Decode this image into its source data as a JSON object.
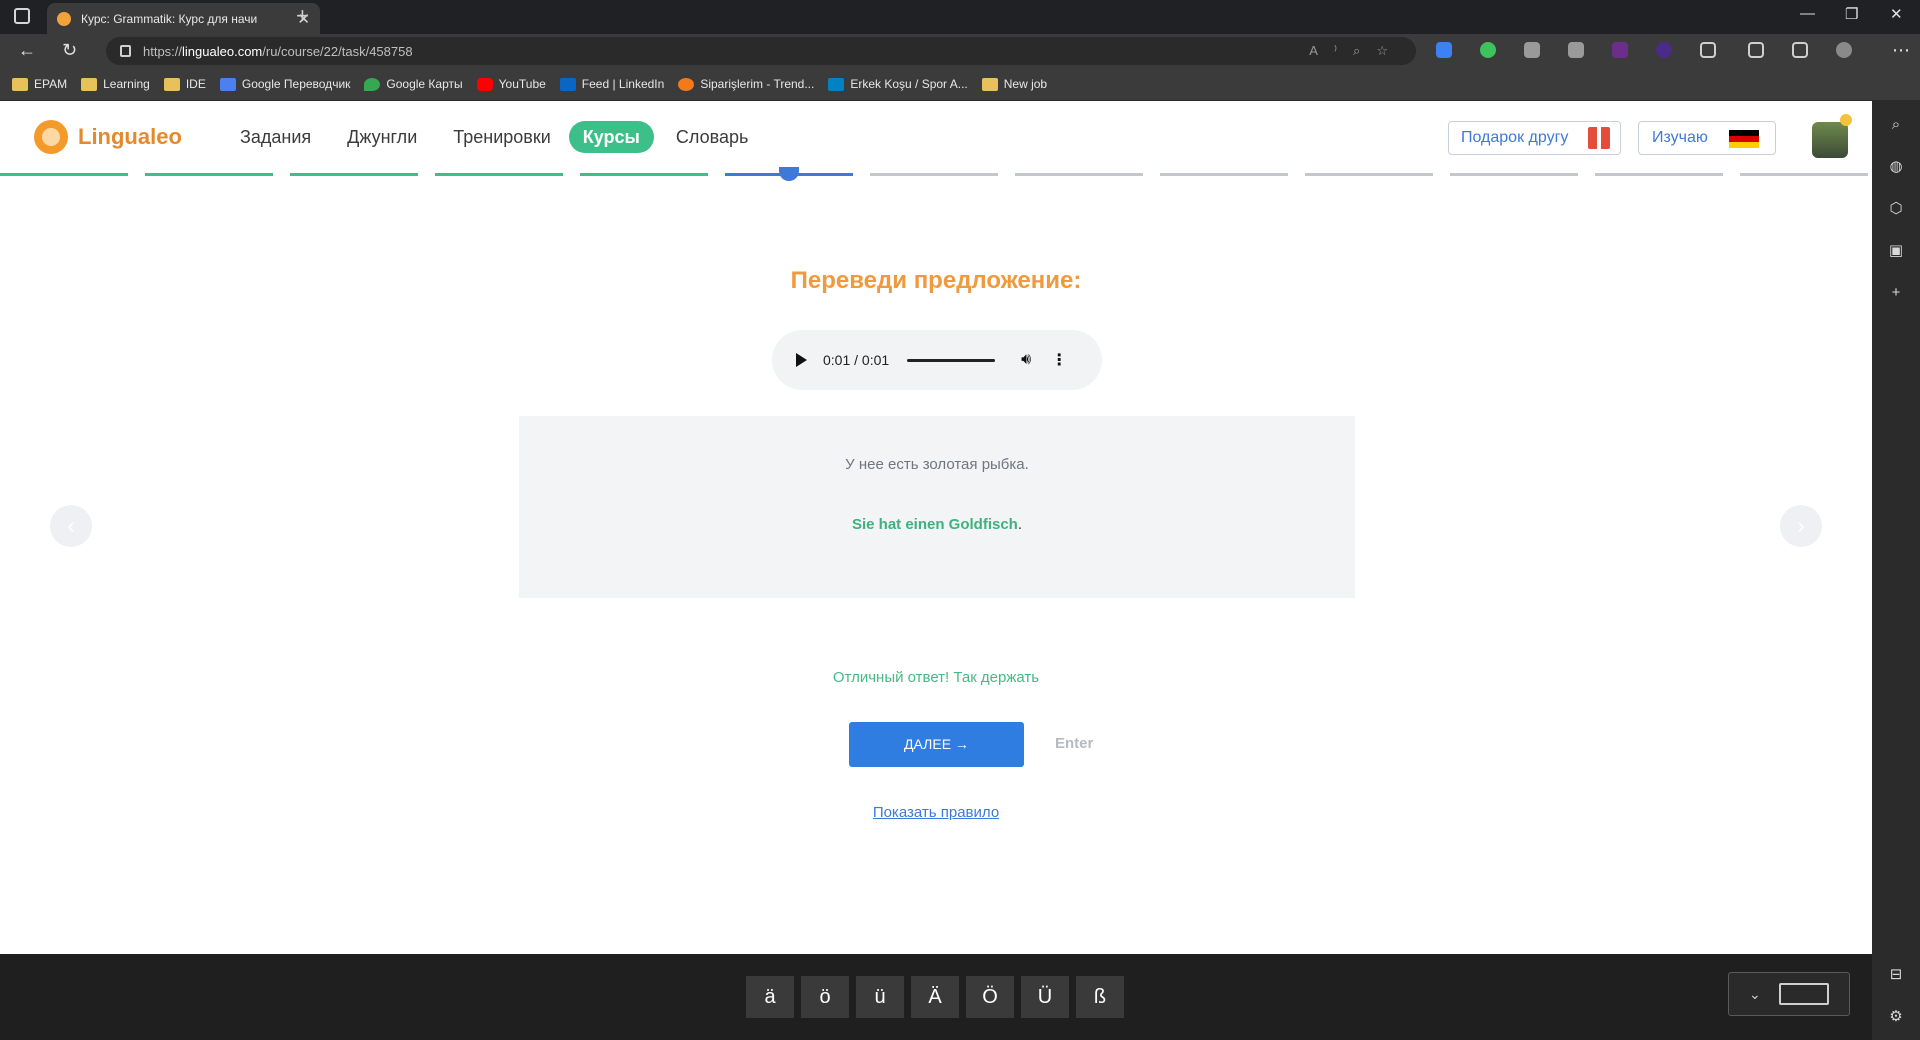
{
  "browser": {
    "tab_title": "Курс: Grammatik: Курс для начи",
    "url_prefix": "https://",
    "url_host": "lingualeo.com",
    "url_path": "/ru/course/22/task/458758",
    "bookmarks": [
      {
        "label": "EPAM",
        "icon": "folder-icon"
      },
      {
        "label": "Learning",
        "icon": "folder-icon"
      },
      {
        "label": "IDE",
        "icon": "folder-icon"
      },
      {
        "label": "Google Переводчик",
        "icon": "translate-icon"
      },
      {
        "label": "Google Карты",
        "icon": "maps-icon"
      },
      {
        "label": "YouTube",
        "icon": "youtube-icon"
      },
      {
        "label": "Feed | LinkedIn",
        "icon": "linkedin-icon"
      },
      {
        "label": "Siparişlerim - Trend...",
        "icon": "trendyol-icon"
      },
      {
        "label": "Erkek Koşu / Spor A...",
        "icon": "decathlon-icon"
      },
      {
        "label": "New job",
        "icon": "folder-icon"
      }
    ]
  },
  "site": {
    "logo_text": "Lingualeo",
    "nav": [
      "Задания",
      "Джунгли",
      "Тренировки",
      "Курсы",
      "Словарь"
    ],
    "active_nav": "Курсы",
    "gift_button": "Подарок другу",
    "learning_button": "Изучаю",
    "learning_flag": [
      "#000000",
      "#dd0000",
      "#ffce00"
    ]
  },
  "progress": {
    "total": 13,
    "completed": 5,
    "current_index": 5,
    "colors": {
      "done": "#3dbf8a",
      "current": "#3d79d9",
      "todo": "#c4c8ce"
    }
  },
  "task": {
    "title": "Переведи предложение:",
    "audio_time": "0:01 / 0:01",
    "source_sentence": "У нее есть золотая рыбка.",
    "answer": "Sie hat einen Goldfisch",
    "answer_punct": ".",
    "feedback": "Отличный ответ! Так держать",
    "next_button": "ДАЛЕЕ →",
    "enter_hint": "Enter",
    "rule_link": "Показать правило"
  },
  "special_chars": [
    "ä",
    "ö",
    "ü",
    "Ä",
    "Ö",
    "Ü",
    "ß"
  ]
}
